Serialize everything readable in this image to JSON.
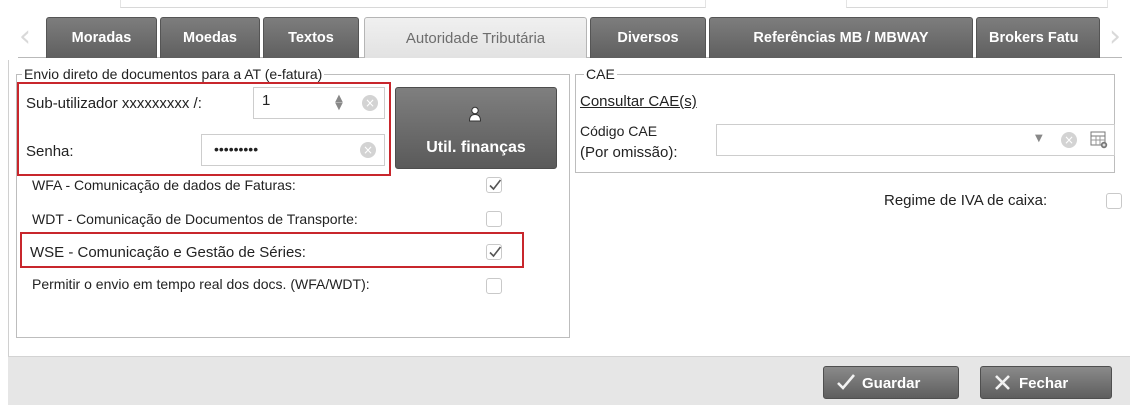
{
  "tabs": [
    {
      "label": "Moradas",
      "active": false
    },
    {
      "label": "Moedas",
      "active": false
    },
    {
      "label": "Textos",
      "active": false
    },
    {
      "label": "Autoridade Tributária",
      "active": true
    },
    {
      "label": "Diversos",
      "active": false
    },
    {
      "label": "Referências MB / MBWAY",
      "active": false
    },
    {
      "label": "Brokers Fatu",
      "active": false
    }
  ],
  "efatura": {
    "legend": "Envio direto de documentos para a AT (e-fatura)",
    "subuser_label": "Sub-utilizador xxxxxxxxx /:",
    "subuser_value": "1",
    "password_label": "Senha:",
    "password_value": "•••••••••",
    "finance_button_label": "Util. finanças",
    "options": [
      {
        "label": "WFA - Comunicação de dados de Faturas:",
        "checked": true
      },
      {
        "label": "WDT - Comunicação de Documentos de Transporte:",
        "checked": false
      },
      {
        "label": "WSE - Comunicação e Gestão de Séries:",
        "checked": true
      },
      {
        "label": "Permitir o envio em tempo real dos docs. (WFA/WDT):",
        "checked": false
      }
    ]
  },
  "cae": {
    "legend": "CAE",
    "consult_link": "Consultar CAE(s)",
    "code_label_line1": "Código CAE",
    "code_label_line2": "(Por omissão):",
    "code_value": ""
  },
  "vat_cash_regime": {
    "label": "Regime de IVA de caixa:",
    "checked": false
  },
  "footer": {
    "save_label": "Guardar",
    "close_label": "Fechar"
  },
  "colors": {
    "highlight_border": "#c8262c",
    "tab_bg": "#666666",
    "footer_bg": "#e6e6e6"
  }
}
